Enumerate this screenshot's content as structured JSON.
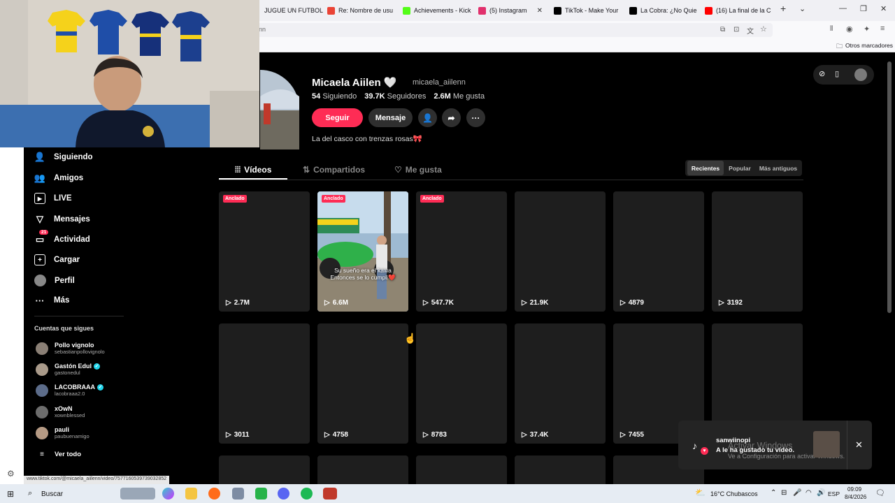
{
  "browser": {
    "tabs": [
      {
        "label": "JUGUE UN FUTBOL",
        "favicon_color": "#fff"
      },
      {
        "label": "Re: Nombre de usu",
        "favicon_color": "#ea4335"
      },
      {
        "label": "Achievements - Kick",
        "favicon_color": "#53fc18"
      },
      {
        "label": "(5) Instagram",
        "favicon_color": "#e1306c"
      },
      {
        "label": "TikTok - Make Your",
        "favicon_color": "#000000"
      },
      {
        "label": "La Cobra: ¿No Quie",
        "favicon_color": "#000000"
      },
      {
        "label": "(16) La final de la C",
        "favicon_color": "#ff0000"
      }
    ],
    "url_text": "nn",
    "bookmarks_label": "Otros marcadores",
    "status_url": "www.tiktok.com/@micaela_aiilenn/video/7577160539739032852"
  },
  "sidebar": {
    "items": [
      {
        "label": "Siguiendo",
        "icon": "person-follow-icon"
      },
      {
        "label": "Amigos",
        "icon": "friends-icon"
      },
      {
        "label": "LIVE",
        "icon": "live-icon"
      },
      {
        "label": "Mensajes",
        "icon": "paper-plane-icon"
      },
      {
        "label": "Actividad",
        "icon": "activity-icon",
        "badge": "21"
      },
      {
        "label": "Cargar",
        "icon": "upload-icon"
      },
      {
        "label": "Perfil",
        "icon": "profile-avatar-icon"
      },
      {
        "label": "Más",
        "icon": "more-dots-icon"
      }
    ],
    "following_title": "Cuentas que sigues",
    "following": [
      {
        "name": "Pollo vignolo",
        "handle": "sebastianpollovignolo",
        "verified": false
      },
      {
        "name": "Gastón Edul",
        "handle": "gastonedul",
        "verified": true
      },
      {
        "name": "LACOBRAAA",
        "handle": "lacobraaa2.0",
        "verified": true
      },
      {
        "name": "xOwN",
        "handle": "xownblessed",
        "verified": false
      },
      {
        "name": "pauli",
        "handle": "paubuenamigo",
        "verified": false
      }
    ],
    "see_all": "Ver todo"
  },
  "profile": {
    "name": "Micaela Aiilen",
    "name_emoji": "🤍",
    "handle": "micaela_aiilenn",
    "following_count": "54",
    "following_label": "Siguiendo",
    "followers_count": "39.7K",
    "followers_label": "Seguidores",
    "likes_count": "2.6M",
    "likes_label": "Me gusta",
    "bio": "La del casco con trenzas rosas🎀",
    "follow_button": "Seguir",
    "message_button": "Mensaje",
    "accent_color": "#fe2c55"
  },
  "content_tabs": [
    {
      "label": "Vídeos",
      "active": true
    },
    {
      "label": "Compartidos",
      "active": false
    },
    {
      "label": "Me gusta",
      "active": false
    }
  ],
  "sort_options": [
    {
      "label": "Recientes",
      "active": true
    },
    {
      "label": "Popular",
      "active": false
    },
    {
      "label": "Más antiguos",
      "active": false
    }
  ],
  "pinned_label": "Anclado",
  "videos_row1": [
    {
      "views": "2.7M",
      "pinned": true
    },
    {
      "views": "6.6M",
      "pinned": true,
      "caption_line1": "Su sueño era el kawa",
      "caption_line2": "Entonces se lo cumpli❤️"
    },
    {
      "views": "547.7K",
      "pinned": true
    },
    {
      "views": "21.9K",
      "pinned": false
    },
    {
      "views": "4879",
      "pinned": false
    },
    {
      "views": "3192",
      "pinned": false
    }
  ],
  "videos_row2": [
    {
      "views": "3011"
    },
    {
      "views": "4758"
    },
    {
      "views": "8783"
    },
    {
      "views": "37.4K"
    },
    {
      "views": "7455"
    },
    {
      "views": ""
    }
  ],
  "notification": {
    "user": "sanwiinopi",
    "text": "A le ha gustado tu vídeo.",
    "watermark_title": "Activar Windows",
    "watermark_sub": "Ve a Configuración para activar Windows."
  },
  "taskbar": {
    "search_label": "Buscar",
    "weather": "16°C  Chubascos",
    "lang": "ESP",
    "time": "09:09",
    "date": "8/4/2026"
  }
}
